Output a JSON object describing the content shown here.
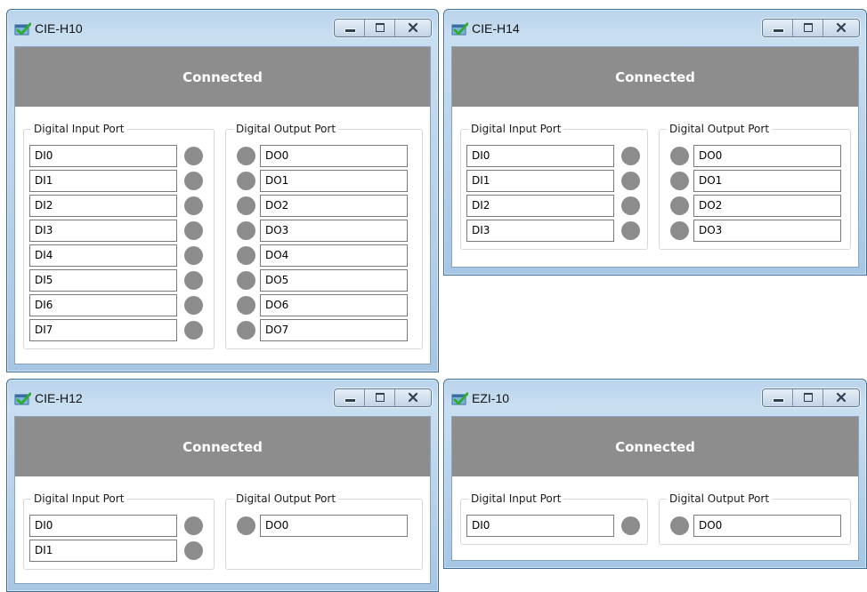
{
  "colors": {
    "status_bar_bg": "#8d8d8d",
    "status_text": "#ffffff",
    "led_off": "#8c8c8c",
    "titlebar_glass": "#b9d3ec"
  },
  "icons": {
    "app": "checkmark-window-icon",
    "minimize": "minimize-icon",
    "maximize": "maximize-icon",
    "close": "close-icon"
  },
  "group_labels": {
    "input": "Digital Input Port",
    "output": "Digital Output Port"
  },
  "windows": [
    {
      "title": "CIE-H10",
      "status": "Connected",
      "inputs": [
        "DI0",
        "DI1",
        "DI2",
        "DI3",
        "DI4",
        "DI5",
        "DI6",
        "DI7"
      ],
      "outputs": [
        "DO0",
        "DO1",
        "DO2",
        "DO3",
        "DO4",
        "DO5",
        "DO6",
        "DO7"
      ]
    },
    {
      "title": "CIE-H14",
      "status": "Connected",
      "inputs": [
        "DI0",
        "DI1",
        "DI2",
        "DI3"
      ],
      "outputs": [
        "DO0",
        "DO1",
        "DO2",
        "DO3"
      ]
    },
    {
      "title": "CIE-H12",
      "status": "Connected",
      "inputs": [
        "DI0",
        "DI1"
      ],
      "outputs": [
        "DO0"
      ]
    },
    {
      "title": "EZI-10",
      "status": "Connected",
      "inputs": [
        "DI0"
      ],
      "outputs": [
        "DO0"
      ]
    }
  ]
}
